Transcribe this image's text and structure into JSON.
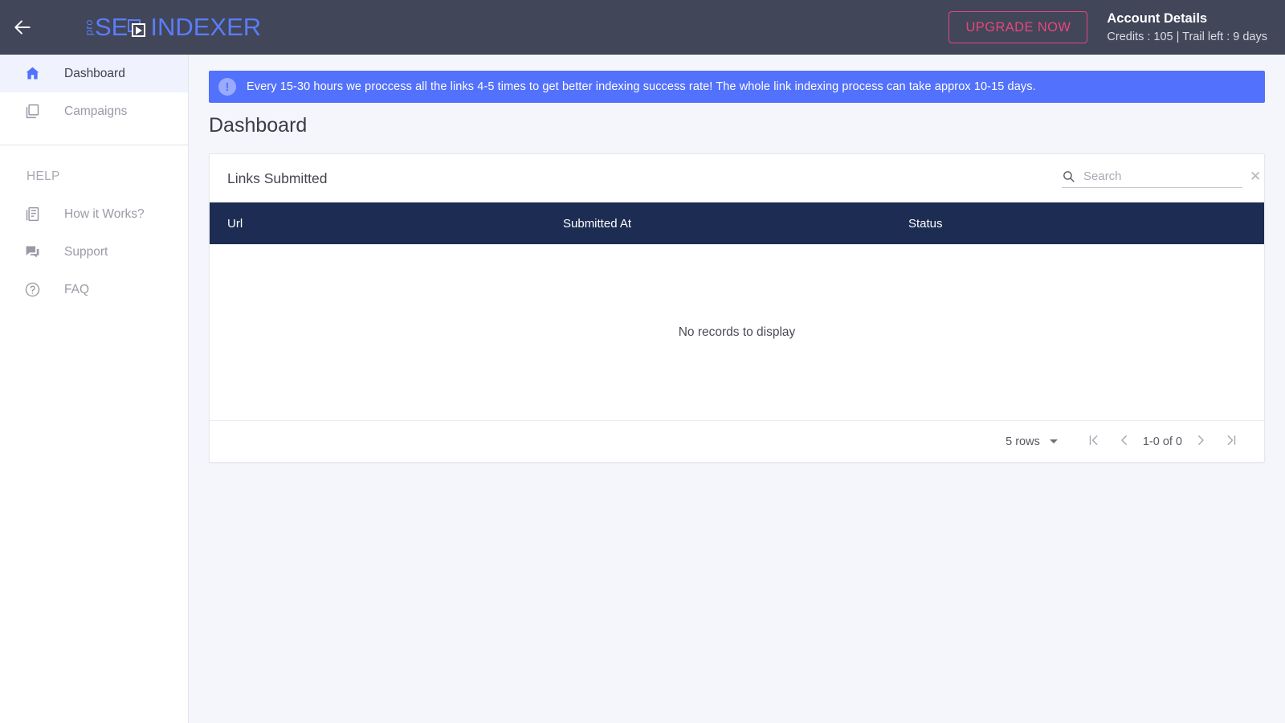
{
  "header": {
    "back_icon": "arrow-left-icon",
    "logo": {
      "pro": "pro",
      "se": "SE",
      "mark_icon": "overlapping-squares-play-icon",
      "indexer": "INDEXER"
    },
    "upgrade_label": "UPGRADE NOW",
    "account_title": "Account Details",
    "account_sub": "Credits : 105 | Trail left : 9 days",
    "colors": {
      "bar": "#414659",
      "logo_blue": "#5b7cfa",
      "upgrade_pink": "#e8467c"
    }
  },
  "sidebar": {
    "items": [
      {
        "label": "Dashboard",
        "icon": "home-icon",
        "active": true
      },
      {
        "label": "Campaigns",
        "icon": "library-icon",
        "active": false
      }
    ],
    "help_heading": "HELP",
    "help_items": [
      {
        "label": "How it Works?",
        "icon": "article-icon"
      },
      {
        "label": "Support",
        "icon": "forum-icon"
      },
      {
        "label": "FAQ",
        "icon": "help-circle-icon"
      }
    ],
    "active_bg": "#f0f2fd"
  },
  "main": {
    "banner": {
      "icon": "exclamation-circle-icon",
      "text": "Every 15-30 hours we proccess all the links 4-5 times to get better indexing success rate! The whole link indexing process can take approx 10-15 days.",
      "color": "#5271fc"
    },
    "page_title": "Dashboard",
    "card": {
      "title": "Links Submitted",
      "search": {
        "icon": "search-icon",
        "placeholder": "Search",
        "value": "",
        "clear_icon": "close-icon"
      },
      "table": {
        "header_color": "#1c2c52",
        "columns": [
          "Url",
          "Submitted At",
          "Status"
        ],
        "rows": [],
        "empty_text": "No records to display"
      },
      "pagination": {
        "rows_per_page": "5 rows",
        "first_icon": "first-page-icon",
        "prev_icon": "chevron-left-icon",
        "range": "1-0 of 0",
        "next_icon": "chevron-right-icon",
        "last_icon": "last-page-icon"
      }
    }
  }
}
